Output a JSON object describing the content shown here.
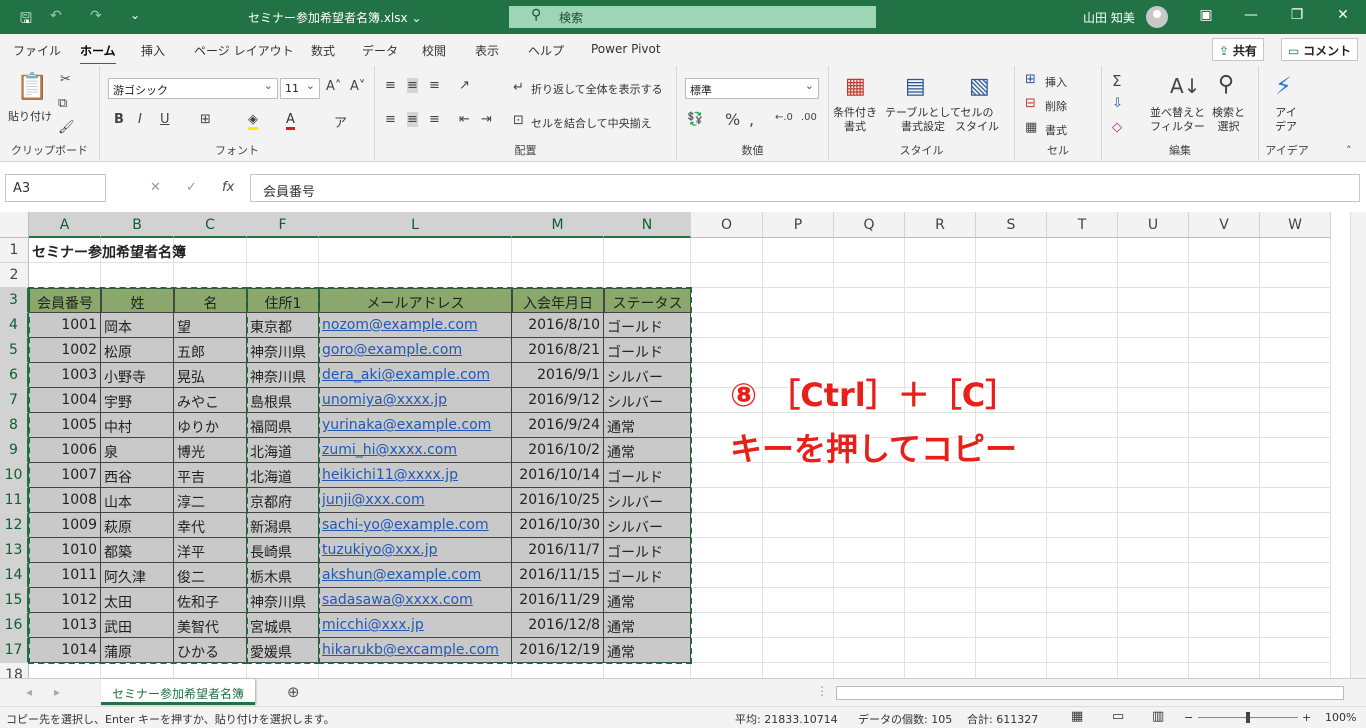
{
  "title_bar": {
    "save_icon": "save-icon",
    "undo_icon": "undo-icon",
    "redo_icon": "redo-icon",
    "customize_icon": "customize-quick-access-icon",
    "document_title": "セミナー参加希望者名簿.xlsx",
    "document_chevron": "⌄",
    "search_placeholder": "検索",
    "user_name": "山田 知美",
    "ribbon_display_icon": "ribbon-display-icon",
    "minimize_icon": "minimize-icon",
    "restore_icon": "restore-icon",
    "close_icon": "close-icon"
  },
  "tabs": [
    "ファイル",
    "ホーム",
    "挿入",
    "ページ レイアウト",
    "数式",
    "データ",
    "校閲",
    "表示",
    "ヘルプ",
    "Power Pivot"
  ],
  "share_button": "共有",
  "comment_button": "コメント",
  "ribbon": {
    "clipboard": {
      "paste": "貼り付け",
      "label": "クリップボード"
    },
    "font": {
      "font_name": "游ゴシック",
      "font_size": "11",
      "bold": "B",
      "italic": "I",
      "underline": "U",
      "label": "フォント"
    },
    "alignment": {
      "wrap": "折り返して全体を表示する",
      "merge": "セルを結合して中央揃え",
      "label": "配置"
    },
    "number": {
      "format": "標準",
      "label": "数値"
    },
    "styles": {
      "conditional": "条件付き\n書式",
      "table": "テーブルとして\n書式設定",
      "cell_style": "セルの\nスタイル",
      "label": "スタイル"
    },
    "cells": {
      "insert": "挿入",
      "delete": "削除",
      "format": "書式",
      "label": "セル"
    },
    "editing": {
      "sort": "並べ替えと\nフィルター",
      "find": "検索と\n選択",
      "label": "編集"
    },
    "ideas": {
      "ideas": "アイ\nデア",
      "label": "アイデア"
    }
  },
  "formula_bar": {
    "name_box": "A3",
    "cancel": "✕",
    "enter": "✓",
    "fx": "fx",
    "value": "会員番号"
  },
  "columns": [
    "A",
    "B",
    "C",
    "F",
    "L",
    "M",
    "N",
    "O",
    "P",
    "Q",
    "R",
    "S",
    "T",
    "U",
    "V",
    "W"
  ],
  "sheet": {
    "title": "セミナー参加希望者名簿",
    "headers": [
      "会員番号",
      "姓",
      "名",
      "住所1",
      "メールアドレス",
      "入会年月日",
      "ステータス"
    ],
    "rows": [
      [
        "1001",
        "岡本",
        "望",
        "東京都",
        "nozom@example.com",
        "2016/8/10",
        "ゴールド"
      ],
      [
        "1002",
        "松原",
        "五郎",
        "神奈川県",
        "goro@example.com",
        "2016/8/21",
        "ゴールド"
      ],
      [
        "1003",
        "小野寺",
        "晃弘",
        "神奈川県",
        "dera_aki@example.com",
        "2016/9/1",
        "シルバー"
      ],
      [
        "1004",
        "宇野",
        "みやこ",
        "島根県",
        "unomiya@xxxx.jp",
        "2016/9/12",
        "シルバー"
      ],
      [
        "1005",
        "中村",
        "ゆりか",
        "福岡県",
        "yurinaka@example.com",
        "2016/9/24",
        "通常"
      ],
      [
        "1006",
        "泉",
        "博光",
        "北海道",
        "zumi_hi@xxxx.com",
        "2016/10/2",
        "通常"
      ],
      [
        "1007",
        "西谷",
        "平吉",
        "北海道",
        "heikichi11@xxxx.jp",
        "2016/10/14",
        "ゴールド"
      ],
      [
        "1008",
        "山本",
        "淳二",
        "京都府",
        "junji@xxx.com",
        "2016/10/25",
        "シルバー"
      ],
      [
        "1009",
        "萩原",
        "幸代",
        "新潟県",
        "sachi-yo@example.com",
        "2016/10/30",
        "シルバー"
      ],
      [
        "1010",
        "都築",
        "洋平",
        "長崎県",
        "tuzukiyo@xxx.jp",
        "2016/11/7",
        "ゴールド"
      ],
      [
        "1011",
        "阿久津",
        "俊二",
        "栃木県",
        "akshun@example.com",
        "2016/11/15",
        "ゴールド"
      ],
      [
        "1012",
        "太田",
        "佐和子",
        "神奈川県",
        "sadasawa@xxxx.com",
        "2016/11/29",
        "通常"
      ],
      [
        "1013",
        "武田",
        "美智代",
        "宮城県",
        "micchi@xxx.jp",
        "2016/12/8",
        "通常"
      ],
      [
        "1014",
        "蒲原",
        "ひかる",
        "愛媛県",
        "hikarukb@excample.com",
        "2016/12/19",
        "通常"
      ]
    ]
  },
  "annotation": {
    "line1": "⑧ ［Ctrl］＋［C］",
    "line2": "キーを押してコピー"
  },
  "sheet_tab": "セミナー参加希望者名簿",
  "add_sheet": "⊕",
  "status": {
    "message": "コピー先を選択し、Enter キーを押すか、貼り付けを選択します。",
    "average": "平均: 21833.10714",
    "count": "データの個数: 105",
    "sum": "合計: 611327",
    "zoom": "100%"
  }
}
